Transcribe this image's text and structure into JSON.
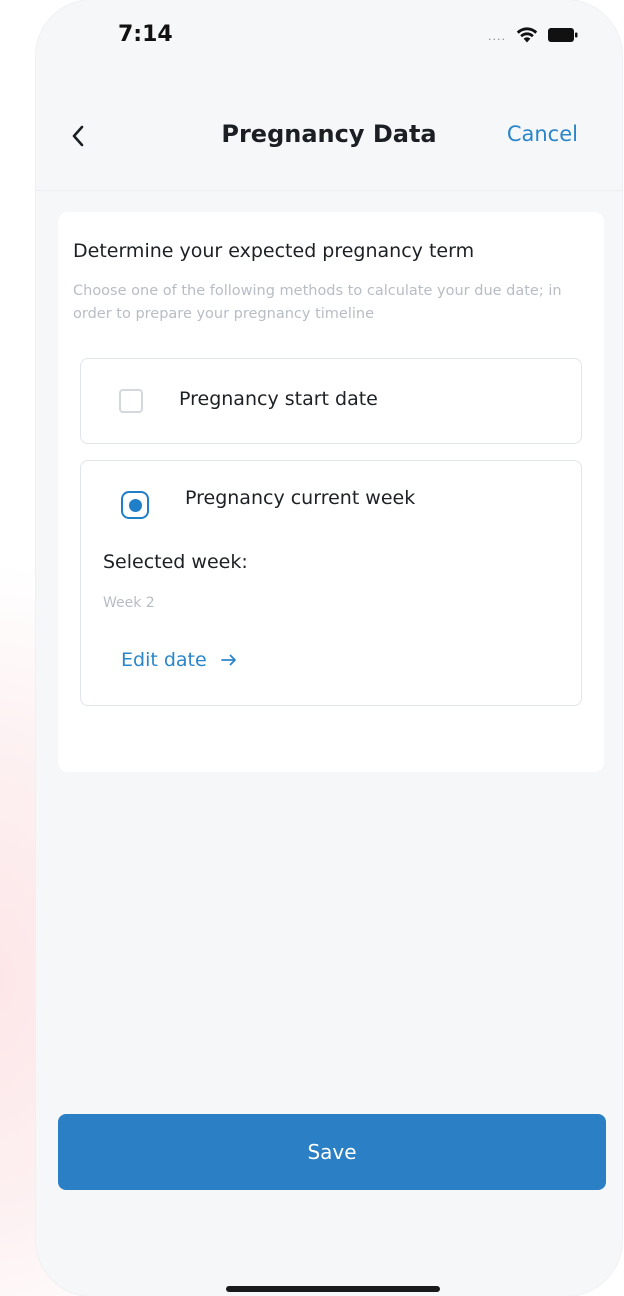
{
  "status_bar": {
    "time": "7:14",
    "signal": "....",
    "icons": [
      "wifi-icon",
      "battery-icon"
    ]
  },
  "nav": {
    "back_icon": "chevron-left-icon",
    "title": "Pregnancy Data",
    "cancel_label": "Cancel"
  },
  "card": {
    "title": "Determine your expected pregnancy term",
    "subtitle": "Choose one of the following methods to calculate your due date; in order to prepare your pregnancy timeline"
  },
  "options": {
    "start_date": {
      "label": "Pregnancy start date",
      "checked": false
    },
    "current_week": {
      "label": "Pregnancy current week",
      "checked": true,
      "selected_week_label": "Selected week:",
      "selected_week_value": "Week 2",
      "edit_label": "Edit date",
      "edit_icon": "arrow-right-icon"
    }
  },
  "save_label": "Save",
  "colors": {
    "accent": "#2b7fc4",
    "link": "#2a86c9",
    "muted_text": "#b8bcc4",
    "background": "#f6f7f9"
  }
}
